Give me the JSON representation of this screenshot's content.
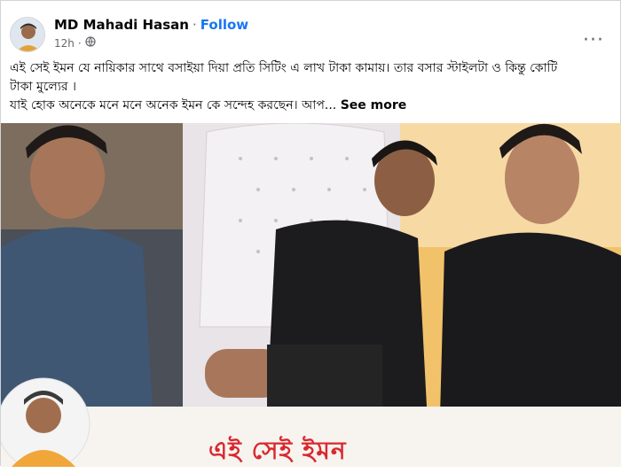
{
  "post": {
    "author": "MD Mahadi Hasan",
    "separator": "·",
    "follow_label": "Follow",
    "time": "12h",
    "privacy_icon": "globe-icon",
    "more_icon": "more-horizontal-icon",
    "body_line1": "এই সেই ইমন যে নায়িকার সাথে বসাইয়া দিয়া প্রতি সিটিং এ লাখ টাকা কামায়।  তার বসার স্টাইলটা ও কিন্তু কোটি",
    "body_line2": "টাকা মুল্যের ।",
    "body_line3": "যাই হোক অনেকে মনে মনে অনেক ইমন কে সন্দেহ করছেন। আপ...",
    "see_more_label": "See more",
    "image_caption": "এই সেই ইমন"
  },
  "colors": {
    "accent": "#1877f2",
    "meta_text": "#65676b",
    "caption_red": "#d8282f"
  }
}
